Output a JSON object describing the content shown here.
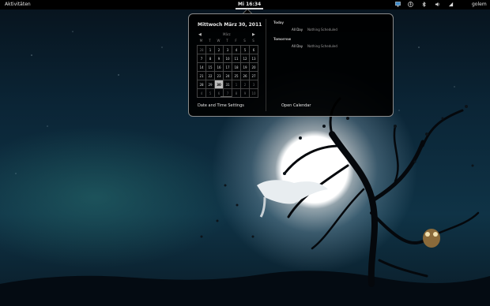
{
  "topbar": {
    "activities": "Aktivitäten",
    "clock": "Mi 16:34",
    "user": "golem",
    "tray_icons": [
      "display-icon",
      "accessibility-icon",
      "bluetooth-icon",
      "volume-icon",
      "network-icon"
    ]
  },
  "calendar": {
    "date_heading": "Mittwoch März 30, 2011",
    "month": "März",
    "prev_symbol": "◀",
    "next_symbol": "▶",
    "weekdays": [
      "M",
      "T",
      "W",
      "T",
      "F",
      "S",
      "S"
    ],
    "days": [
      "28",
      "1",
      "2",
      "3",
      "4",
      "5",
      "6",
      "7",
      "8",
      "9",
      "10",
      "11",
      "12",
      "13",
      "14",
      "15",
      "16",
      "17",
      "18",
      "19",
      "20",
      "21",
      "22",
      "23",
      "24",
      "25",
      "26",
      "27",
      "28",
      "29",
      "30",
      "31",
      "1",
      "2",
      "3",
      "4",
      "5",
      "6",
      "7",
      "8",
      "9",
      "10"
    ],
    "dim_days": [
      0,
      32,
      33,
      34,
      35,
      36,
      37,
      38,
      39,
      40,
      41
    ],
    "today_index": 30,
    "settings_label": "Date and Time Settings"
  },
  "events": {
    "today_label": "Today",
    "today_time": "All Day",
    "today_text": "Nothing Scheduled",
    "tomorrow_label": "Tomorrow",
    "tomorrow_time": "All Day",
    "tomorrow_text": "Nothing Scheduled",
    "open_calendar_label": "Open Calendar"
  },
  "colors": {
    "panel": "#000000",
    "popup_border": "#8a8a8a",
    "today_highlight": "#bdbdbd"
  }
}
